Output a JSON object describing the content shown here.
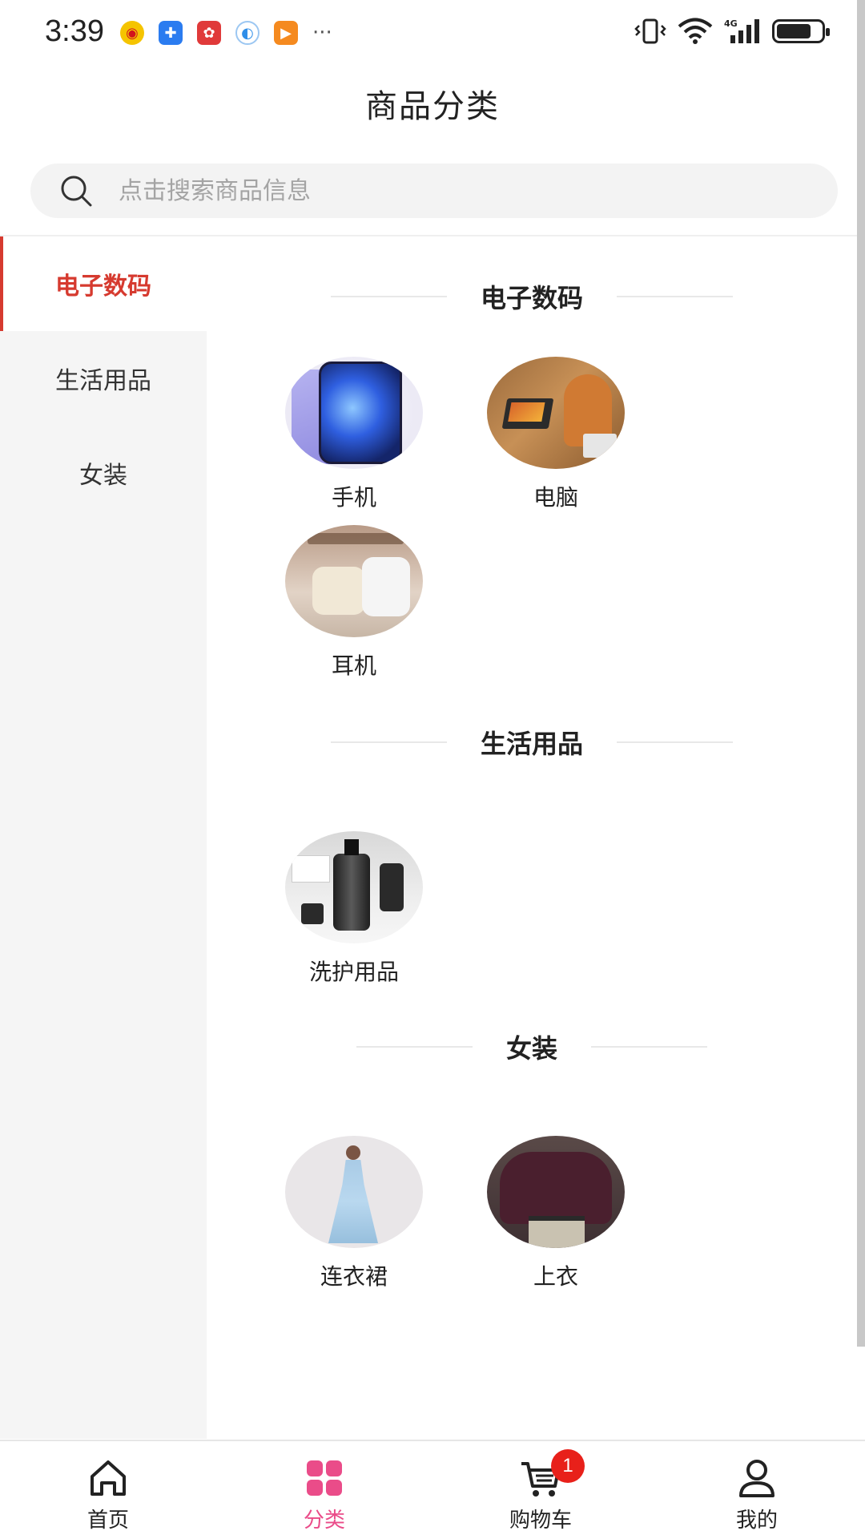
{
  "status_bar": {
    "time": "3:39",
    "more": "···",
    "network": "4G",
    "icons": [
      "weibo-icon",
      "puzzle-icon",
      "huawei-icon",
      "globe-icon",
      "play-icon",
      "vibrate-icon",
      "wifi-icon",
      "signal-icon",
      "battery-icon"
    ]
  },
  "header": {
    "title": "商品分类"
  },
  "search": {
    "placeholder": "点击搜索商品信息"
  },
  "sidebar": {
    "items": [
      {
        "label": "电子数码",
        "active": true
      },
      {
        "label": "生活用品",
        "active": false
      },
      {
        "label": "女装",
        "active": false
      }
    ]
  },
  "sections": [
    {
      "title": "电子数码",
      "items": [
        {
          "label": "手机"
        },
        {
          "label": "电脑"
        },
        {
          "label": "耳机"
        }
      ]
    },
    {
      "title": "生活用品",
      "items": [
        {
          "label": "洗护用品"
        }
      ]
    },
    {
      "title": "女装",
      "items": [
        {
          "label": "连衣裙"
        },
        {
          "label": "上衣"
        }
      ]
    }
  ],
  "bottom_nav": {
    "items": [
      {
        "label": "首页",
        "icon": "home-icon"
      },
      {
        "label": "分类",
        "icon": "category-icon",
        "active": true
      },
      {
        "label": "购物车",
        "icon": "cart-icon",
        "badge": "1"
      },
      {
        "label": "我的",
        "icon": "user-icon"
      }
    ]
  },
  "colors": {
    "accent_red": "#d63a2f",
    "active_tab": "#ea4c89",
    "badge": "#e8201a"
  }
}
